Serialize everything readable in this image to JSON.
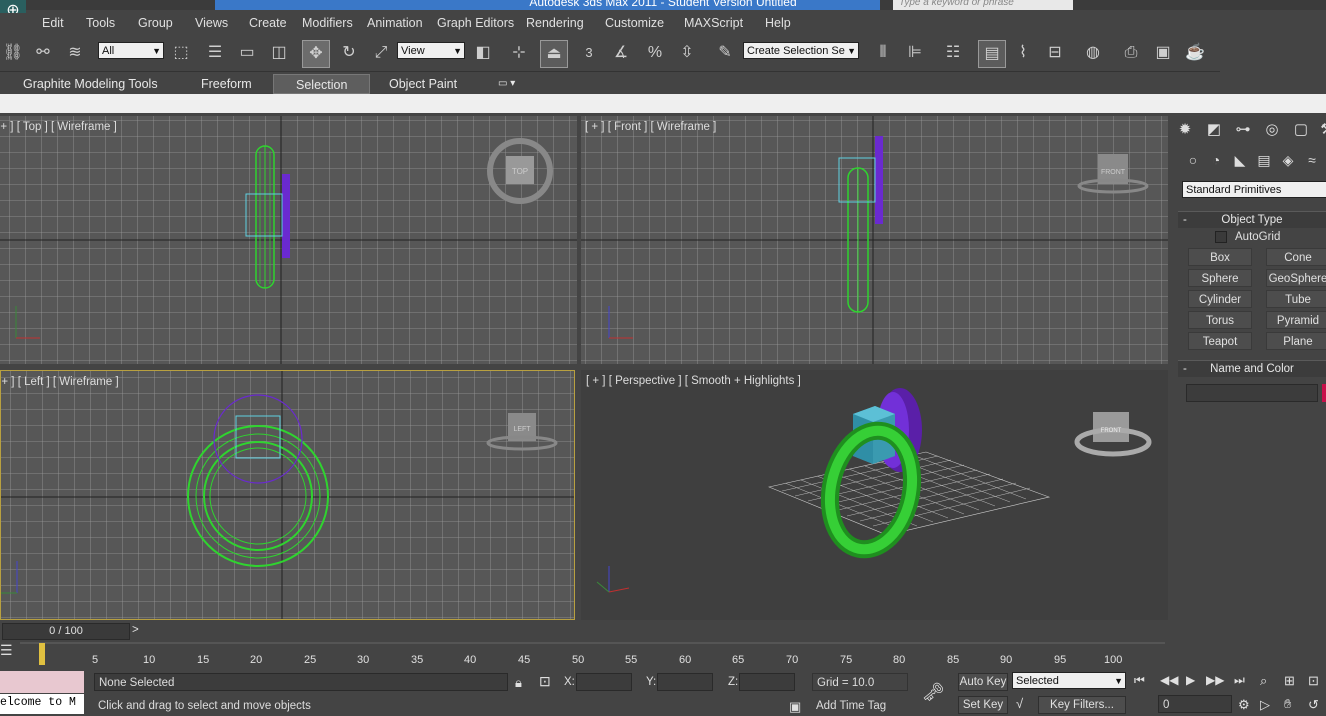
{
  "window": {
    "title": "Autodesk 3ds Max  2011  - Student Version   Untitled",
    "search_placeholder": "Type a keyword or phrase"
  },
  "menu": [
    "Edit",
    "Tools",
    "Group",
    "Views",
    "Create",
    "Modifiers",
    "Animation",
    "Graph Editors",
    "Rendering",
    "Customize",
    "MAXScript",
    "Help"
  ],
  "toolbar": {
    "filter_value": "All",
    "refcoord_value": "View",
    "snap_label": "3",
    "selset_value": "Create Selection Se"
  },
  "ribbon": {
    "tabs": [
      "Graphite Modeling Tools",
      "Freeform",
      "Selection",
      "Object Paint"
    ],
    "active": "Selection"
  },
  "viewports": {
    "top": {
      "label": "[ + ] [ Top ] [ Wireframe ]",
      "cube_label": "TOP"
    },
    "front": {
      "label": "[ + ] [ Front ] [ Wireframe ]",
      "cube_label": "FRONT"
    },
    "left": {
      "label": "[ + ] [ Left ] [ Wireframe ]",
      "cube_label": "LEFT"
    },
    "perspective": {
      "label": "[ + ] [ Perspective ] [ Smooth + Highlights ]",
      "cube_label": "FRONT"
    }
  },
  "command_panel": {
    "category_value": "Standard Primitives",
    "object_type_title": "Object Type",
    "autogrid_label": "AutoGrid",
    "buttons": [
      "Box",
      "Cone",
      "Sphere",
      "GeoSphere",
      "Cylinder",
      "Tube",
      "Torus",
      "Pyramid",
      "Teapot",
      "Plane"
    ],
    "name_color_title": "Name and Color",
    "name_value": "",
    "object_color": "#c8104a"
  },
  "timeline": {
    "slider_value": "0 / 100",
    "ticks": [
      "5",
      "10",
      "15",
      "20",
      "25",
      "30",
      "35",
      "40",
      "45",
      "50",
      "55",
      "60",
      "65",
      "70",
      "75",
      "80",
      "85",
      "90",
      "95",
      "100"
    ]
  },
  "status": {
    "maxscript_listener": "elcome to M",
    "selection_info": "None Selected",
    "prompt": "Click and drag to select and move objects",
    "x_label": "X:",
    "y_label": "Y:",
    "z_label": "Z:",
    "x_value": "",
    "y_value": "",
    "z_value": "",
    "grid": "Grid = 10.0",
    "add_time_tag": "Add Time Tag",
    "auto_key": "Auto Key",
    "set_key": "Set Key",
    "selected_value": "Selected",
    "key_filters": "Key Filters...",
    "frame_value": "0"
  },
  "colors": {
    "wire_green": "#2fd42f",
    "wire_purple": "#6a2ad0",
    "selection_cyan": "#5fd0e0",
    "grid_line": "#9a9a9a",
    "viewport_bg": "#575757"
  }
}
